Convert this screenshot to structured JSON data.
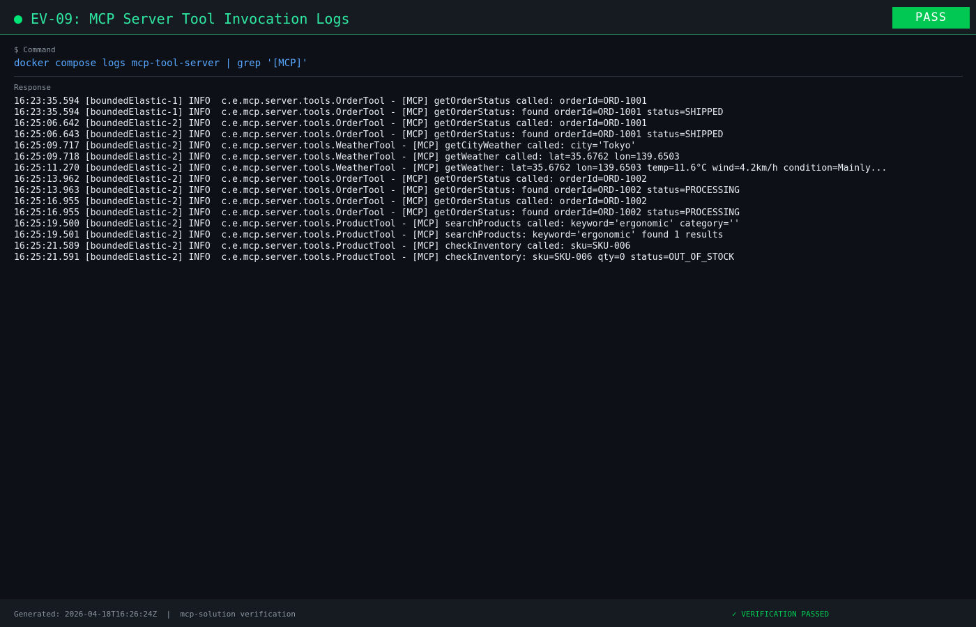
{
  "header": {
    "title": "EV-09: MCP Server Tool Invocation Logs",
    "badge": "PASS"
  },
  "command": {
    "label": "$ Command",
    "text": "docker compose logs mcp-tool-server | grep '[MCP]'"
  },
  "response": {
    "label": "Response",
    "lines": [
      "16:23:35.594 [boundedElastic-1] INFO  c.e.mcp.server.tools.OrderTool - [MCP] getOrderStatus called: orderId=ORD-1001",
      "16:23:35.594 [boundedElastic-1] INFO  c.e.mcp.server.tools.OrderTool - [MCP] getOrderStatus: found orderId=ORD-1001 status=SHIPPED",
      "16:25:06.642 [boundedElastic-2] INFO  c.e.mcp.server.tools.OrderTool - [MCP] getOrderStatus called: orderId=ORD-1001",
      "16:25:06.643 [boundedElastic-2] INFO  c.e.mcp.server.tools.OrderTool - [MCP] getOrderStatus: found orderId=ORD-1001 status=SHIPPED",
      "16:25:09.717 [boundedElastic-2] INFO  c.e.mcp.server.tools.WeatherTool - [MCP] getCityWeather called: city='Tokyo'",
      "16:25:09.718 [boundedElastic-2] INFO  c.e.mcp.server.tools.WeatherTool - [MCP] getWeather called: lat=35.6762 lon=139.6503",
      "16:25:11.270 [boundedElastic-2] INFO  c.e.mcp.server.tools.WeatherTool - [MCP] getWeather: lat=35.6762 lon=139.6503 temp=11.6°C wind=4.2km/h condition=Mainly...",
      "16:25:13.962 [boundedElastic-2] INFO  c.e.mcp.server.tools.OrderTool - [MCP] getOrderStatus called: orderId=ORD-1002",
      "16:25:13.963 [boundedElastic-2] INFO  c.e.mcp.server.tools.OrderTool - [MCP] getOrderStatus: found orderId=ORD-1002 status=PROCESSING",
      "16:25:16.955 [boundedElastic-2] INFO  c.e.mcp.server.tools.OrderTool - [MCP] getOrderStatus called: orderId=ORD-1002",
      "16:25:16.955 [boundedElastic-2] INFO  c.e.mcp.server.tools.OrderTool - [MCP] getOrderStatus: found orderId=ORD-1002 status=PROCESSING",
      "16:25:19.500 [boundedElastic-2] INFO  c.e.mcp.server.tools.ProductTool - [MCP] searchProducts called: keyword='ergonomic' category=''",
      "16:25:19.501 [boundedElastic-2] INFO  c.e.mcp.server.tools.ProductTool - [MCP] searchProducts: keyword='ergonomic' found 1 results",
      "16:25:21.589 [boundedElastic-2] INFO  c.e.mcp.server.tools.ProductTool - [MCP] checkInventory called: sku=SKU-006",
      "16:25:21.591 [boundedElastic-2] INFO  c.e.mcp.server.tools.ProductTool - [MCP] checkInventory: sku=SKU-006 qty=0 status=OUT_OF_STOCK"
    ]
  },
  "footer": {
    "meta": "Generated: 2026-04-18T16:26:24Z  |  mcp-solution verification",
    "status": "✓ VERIFICATION PASSED"
  },
  "colors": {
    "background": "#0d1117",
    "accent": "#2ee6a0",
    "pass": "#00c853",
    "command": "#58a6ff"
  }
}
